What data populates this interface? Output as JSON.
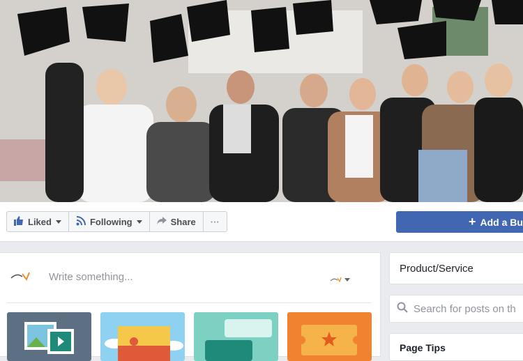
{
  "cover": {
    "description_icon": "graduation-celebration-photo"
  },
  "actions": {
    "liked_label": "Liked",
    "following_label": "Following",
    "share_label": "Share",
    "more_label": "···",
    "add_button_label": "Add a Bu"
  },
  "composer": {
    "placeholder": "Write something...",
    "tiles": [
      "photo-video-icon",
      "shop-icon",
      "chat-icon",
      "event-icon"
    ]
  },
  "sidebar": {
    "category": "Product/Service",
    "search_placeholder": "Search for posts on th",
    "tips_title": "Page Tips"
  },
  "colors": {
    "brand": "#4267b2",
    "text": "#4b4f56"
  }
}
